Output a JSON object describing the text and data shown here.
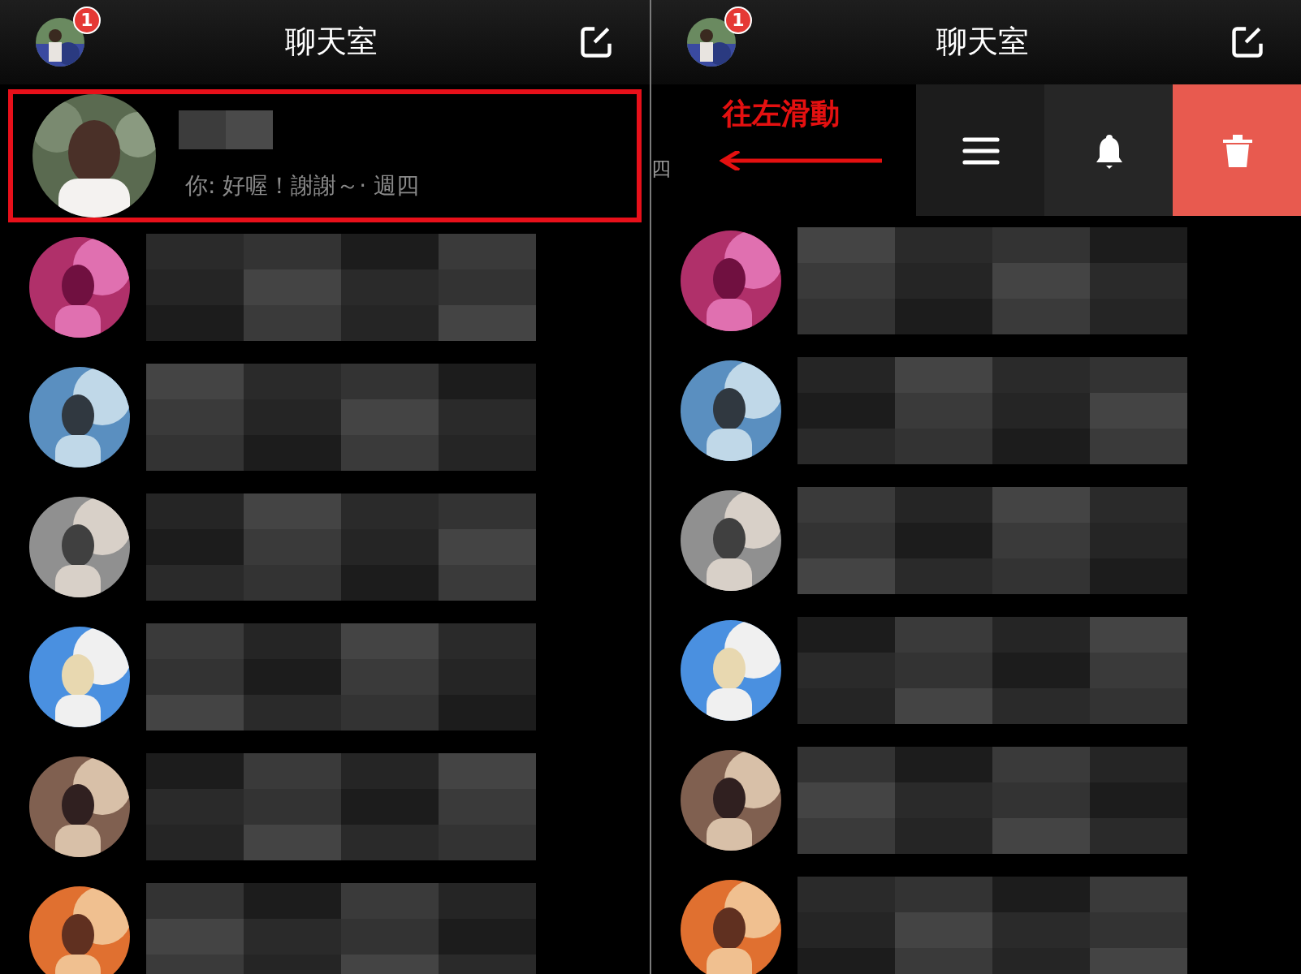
{
  "panels": [
    {
      "header": {
        "title": "聊天室",
        "badge": "1"
      },
      "first": {
        "preview": "你: 好喔！謝謝～· 週四",
        "highlighted": true
      }
    },
    {
      "header": {
        "title": "聊天室",
        "badge": "1"
      },
      "swiped": {
        "preview_fragment": "四",
        "annotation": "往左滑動",
        "actions": [
          {
            "kind": "menu"
          },
          {
            "kind": "bell"
          },
          {
            "kind": "delete"
          }
        ]
      }
    }
  ]
}
